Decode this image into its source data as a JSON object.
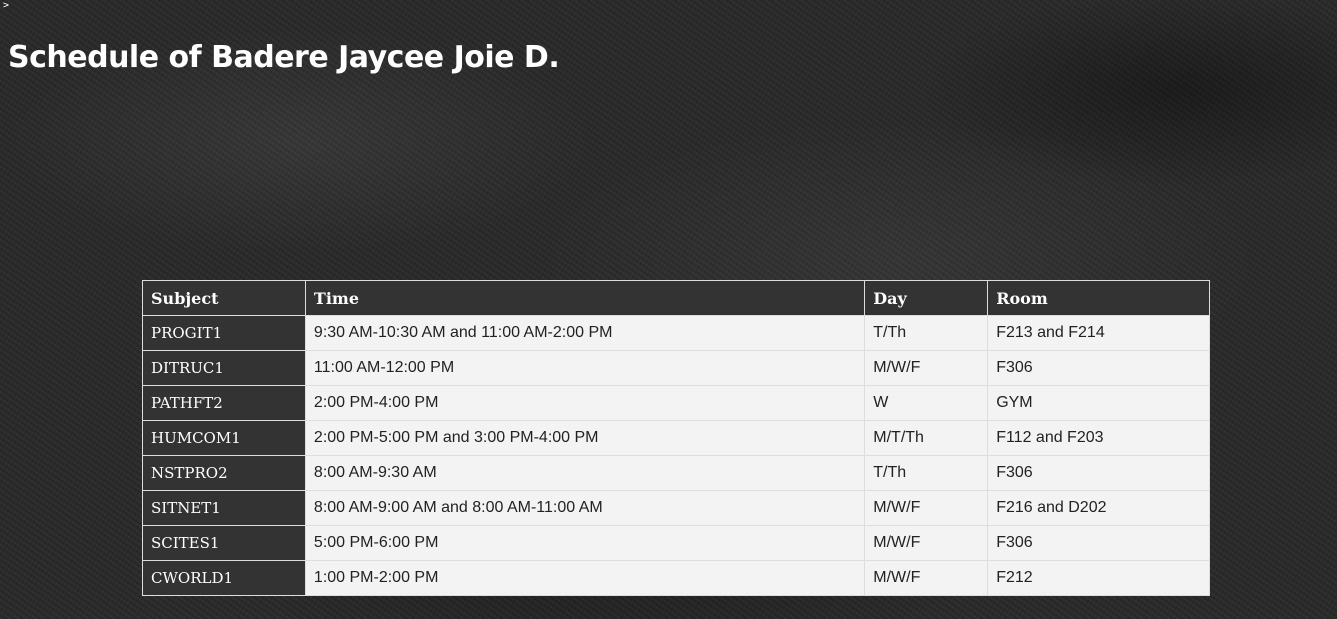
{
  "corner_mark": ">",
  "title": "Schedule of Badere Jaycee Joie D.",
  "table": {
    "headers": {
      "subject": "Subject",
      "time": "Time",
      "day": "Day",
      "room": "Room"
    },
    "rows": [
      {
        "subject": "PROGIT1",
        "time": "9:30 AM-10:30 AM and 11:00 AM-2:00 PM",
        "day": "T/Th",
        "room": "F213 and F214"
      },
      {
        "subject": "DITRUC1",
        "time": "11:00 AM-12:00 PM",
        "day": "M/W/F",
        "room": "F306"
      },
      {
        "subject": "PATHFT2",
        "time": "2:00 PM-4:00 PM",
        "day": "W",
        "room": "GYM"
      },
      {
        "subject": "HUMCOM1",
        "time": "2:00 PM-5:00 PM and 3:00 PM-4:00 PM",
        "day": "M/T/Th",
        "room": "F112 and F203"
      },
      {
        "subject": "NSTPRO2",
        "time": "8:00 AM-9:30 AM",
        "day": "T/Th",
        "room": "F306"
      },
      {
        "subject": "SITNET1",
        "time": "8:00 AM-9:00 AM and 8:00 AM-11:00 AM",
        "day": "M/W/F",
        "room": "F216 and D202"
      },
      {
        "subject": "SCITES1",
        "time": "5:00 PM-6:00 PM",
        "day": "M/W/F",
        "room": "F306"
      },
      {
        "subject": "CWORLD1",
        "time": "1:00 PM-2:00 PM",
        "day": "M/W/F",
        "room": "F212"
      }
    ]
  },
  "colors": {
    "header_bg": "#333333",
    "cell_bg": "#f3f3f3",
    "text_light": "#ffffff",
    "text_dark": "#222222"
  }
}
